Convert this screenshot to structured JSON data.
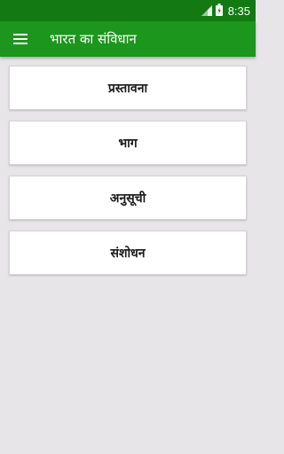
{
  "status_bar": {
    "time": "8:35",
    "icons": [
      "signal-icon",
      "battery-icon"
    ]
  },
  "app_bar": {
    "menu_icon": "hamburger-menu-icon",
    "title": "भारत का संविधान"
  },
  "menu_items": [
    {
      "label": "प्रस्तावना"
    },
    {
      "label": "भाग"
    },
    {
      "label": "अनुसूची"
    },
    {
      "label": "संशोधन"
    }
  ],
  "colors": {
    "status_bar": "#137a13",
    "app_bar": "#1c961c",
    "background": "#e7e5e7",
    "card": "#ffffff"
  }
}
